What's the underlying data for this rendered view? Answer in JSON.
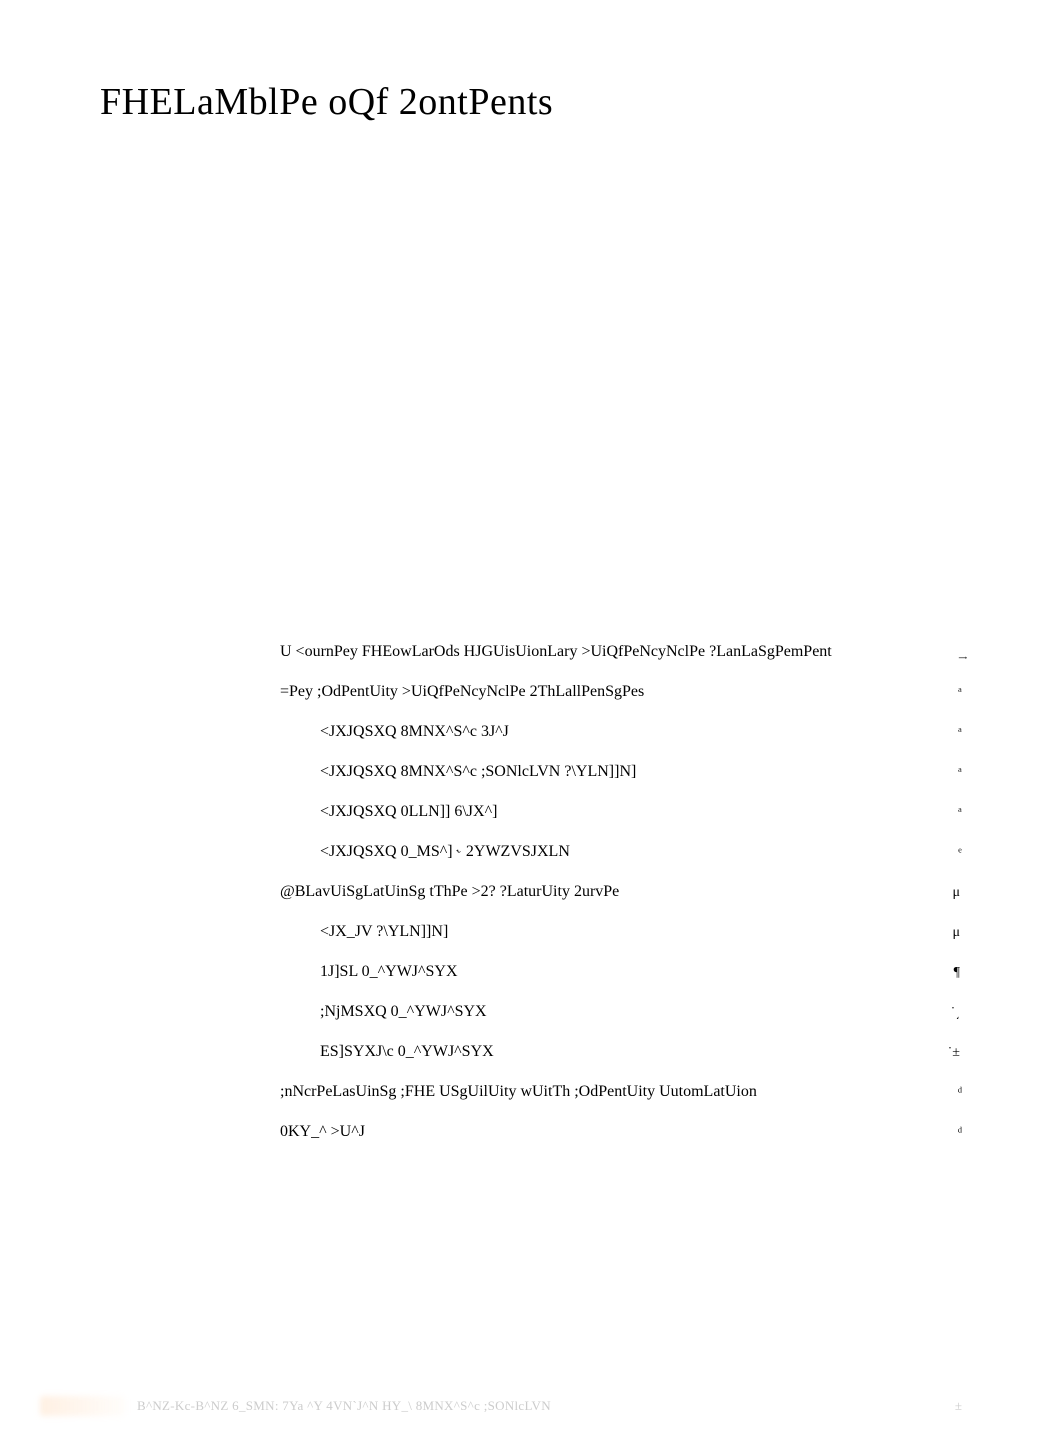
{
  "title": "FHELaMblPe oQf 2ontPents",
  "toc": [
    {
      "label": "U <ournPey FHEowLarOds HJGUisUionLary >UiQfPeNcyNclPe ?LanLaSgPemPent",
      "page": "͢",
      "indent": 0
    },
    {
      "label": "=Pey ;OdPentUity >UiQfPeNcyNclPe 2ThLallPenSgPes",
      "page": "ͣ",
      "indent": 0
    },
    {
      "label": "<JXJQSXQ 8MNX^S^c 3J^J",
      "page": "ͣ",
      "indent": 1
    },
    {
      "label": "<JXJQSXQ 8MNX^S^c ;SONlcLVN ?\\YLN]]N]",
      "page": "ͣ",
      "indent": 1
    },
    {
      "label": "<JXJQSXQ 0LLN]] 6\\JX^]",
      "page": "ͣ",
      "indent": 1
    },
    {
      "label": "<JXJQSXQ 0_MS^]  ˞ 2YWZVSJXLN",
      "page": "ͤ",
      "indent": 1
    },
    {
      "label": "@BLavUiSgLatUinSg tThPe >2? ?LaturUity 2urvPe",
      "page": "μ",
      "indent": 0
    },
    {
      "label": "<JX_JV ?\\YLN]]N]",
      "page": "μ",
      "indent": 1
    },
    {
      "label": "1J]SL 0_^YWJ^SYX",
      "page": "¶",
      "indent": 1
    },
    {
      "label": ";NjMSXQ 0_^YWJ^SYX",
      "page": "˙͵",
      "indent": 1
    },
    {
      "label": "ES]SYXJ\\c 0_^YWJ^SYX",
      "page": "˙±",
      "indent": 1
    },
    {
      "label": ";nNcrPeLasUinSg ;FHE USgUilUity wUitTh ;OdPentUity UutomLatUion",
      "page": "ͩ",
      "indent": 0
    },
    {
      "label": "0KY_^ >U^J",
      "page": "ͩ",
      "indent": 0
    }
  ],
  "footer": {
    "text": "B^NZ-Kc-B^NZ 6_SMN: 7Ya ^Y 4VN`J^N HY_\\ 8MNX^S^c ;SONlcLVN",
    "page": "±"
  }
}
